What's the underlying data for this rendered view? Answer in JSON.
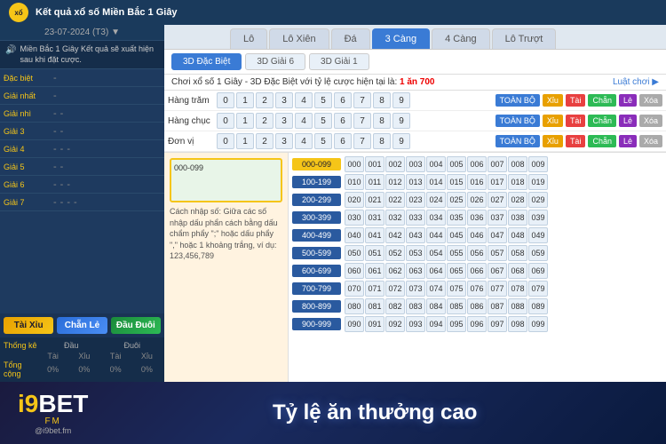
{
  "topbar": {
    "title": "Kết quả xổ số Miền Bắc 1 Giây"
  },
  "sidebar": {
    "date": "23-07-2024 (T3) ▼",
    "notice": "Miền Bắc 1 Giây Kết quả sẽ xuất hiện sau khi đặt cược.",
    "rows": [
      {
        "label": "Đặc biệt",
        "values": []
      },
      {
        "label": "Giải nhất",
        "values": []
      },
      {
        "label": "Giải nhì",
        "values": []
      },
      {
        "label": "Giải 3",
        "values": []
      },
      {
        "label": "Giải 4",
        "values": []
      },
      {
        "label": "Giải 5",
        "values": []
      },
      {
        "label": "Giải 6",
        "values": []
      },
      {
        "label": "Giải 7",
        "values": []
      }
    ],
    "buttons": {
      "tai_xiu": "Tài Xỉu",
      "chan_le": "Chẵn Lẻ",
      "dau_duoi": "Đầu Đuôi"
    },
    "stats": {
      "label": "Thống kê",
      "cols": [
        "Đầu",
        "Đuôi"
      ],
      "sub_cols": [
        "Tài",
        "Xỉu",
        "Tài",
        "Xỉu"
      ],
      "total_label": "Tổng cộng",
      "total_vals": [
        "0%",
        "0%",
        "0%",
        "0%"
      ]
    }
  },
  "tabs": {
    "top": [
      "Lô",
      "Lô Xiên",
      "Đá",
      "3 Càng",
      "4 Càng",
      "Lô Trượt"
    ],
    "active_top": "3 Càng",
    "sub": [
      "3D Đặc Biệt",
      "3D Giải 6",
      "3D Giải 1"
    ],
    "active_sub": "3D Đặc Biệt"
  },
  "bet_info": {
    "text": "Chơi xổ số 1 Giây - 3D Đặc Biệt với tỷ lệ cược hiện tại là:",
    "ratio": "1 ăn 700",
    "luat_choi": "Luật chơi ▶"
  },
  "bet_rows": [
    {
      "label": "Hàng trăm",
      "numbers": [
        "0",
        "1",
        "2",
        "3",
        "4",
        "5",
        "6",
        "7",
        "8",
        "9"
      ],
      "actions": [
        "TOÀN BỘ",
        "Xỉu",
        "Tài",
        "Chẵn",
        "Lẻ",
        "Xóa"
      ]
    },
    {
      "label": "Hàng chục",
      "numbers": [
        "0",
        "1",
        "2",
        "3",
        "4",
        "5",
        "6",
        "7",
        "8",
        "9"
      ],
      "actions": [
        "TOÀN BỘ",
        "Xỉu",
        "Tài",
        "Chẵn",
        "Lẻ",
        "Xóa"
      ]
    },
    {
      "label": "Đơn vị",
      "numbers": [
        "0",
        "1",
        "2",
        "3",
        "4",
        "5",
        "6",
        "7",
        "8",
        "9"
      ],
      "actions": [
        "TOÀN BỘ",
        "Xỉu",
        "Tài",
        "Chẵn",
        "Lẻ",
        "Xóa"
      ]
    }
  ],
  "input_panel": {
    "hint": "Cách nhập số: Giữa các số nhập dấu phẩn cách bằng dấu chẩm phẩy \";\" hoặc dấu phẩy \",\" hoặc 1 khoảng trắng, ví dụ: 123,456,789",
    "placeholder": "000-099"
  },
  "number_grid": {
    "sections": [
      {
        "range": "000-099",
        "highlight": true,
        "numbers": [
          "000",
          "001",
          "002",
          "003",
          "004",
          "005",
          "006",
          "007",
          "008",
          "009"
        ]
      },
      {
        "range": "100-199",
        "numbers": [
          "010",
          "011",
          "012",
          "013",
          "014",
          "015",
          "016",
          "017",
          "018",
          "019"
        ]
      },
      {
        "range": "200-299",
        "numbers": [
          "020",
          "021",
          "022",
          "023",
          "024",
          "025",
          "026",
          "027",
          "028",
          "029"
        ]
      },
      {
        "range": "300-399",
        "numbers": [
          "030",
          "031",
          "032",
          "033",
          "034",
          "035",
          "036",
          "037",
          "038",
          "039"
        ]
      },
      {
        "range": "400-499",
        "numbers": [
          "040",
          "041",
          "042",
          "043",
          "044",
          "045",
          "046",
          "047",
          "048",
          "049"
        ]
      },
      {
        "range": "500-599",
        "numbers": [
          "050",
          "051",
          "052",
          "053",
          "054",
          "055",
          "056",
          "057",
          "058",
          "059"
        ]
      },
      {
        "range": "600-699",
        "numbers": [
          "060",
          "061",
          "062",
          "063",
          "064",
          "065",
          "066",
          "067",
          "068",
          "069"
        ]
      },
      {
        "range": "700-799",
        "numbers": [
          "070",
          "071",
          "072",
          "073",
          "074",
          "075",
          "076",
          "077",
          "078",
          "079"
        ]
      },
      {
        "range": "800-899",
        "numbers": [
          "080",
          "081",
          "082",
          "083",
          "084",
          "085",
          "086",
          "087",
          "088",
          "089"
        ]
      },
      {
        "range": "900-999",
        "numbers": [
          "090",
          "091",
          "092",
          "093",
          "094",
          "095",
          "096",
          "097",
          "098",
          "099"
        ]
      }
    ]
  },
  "banner": {
    "logo": "i9BET",
    "fm": "FM",
    "social": "@i9bet.fm",
    "tagline": "Tỷ lệ ăn thưởng cao"
  }
}
